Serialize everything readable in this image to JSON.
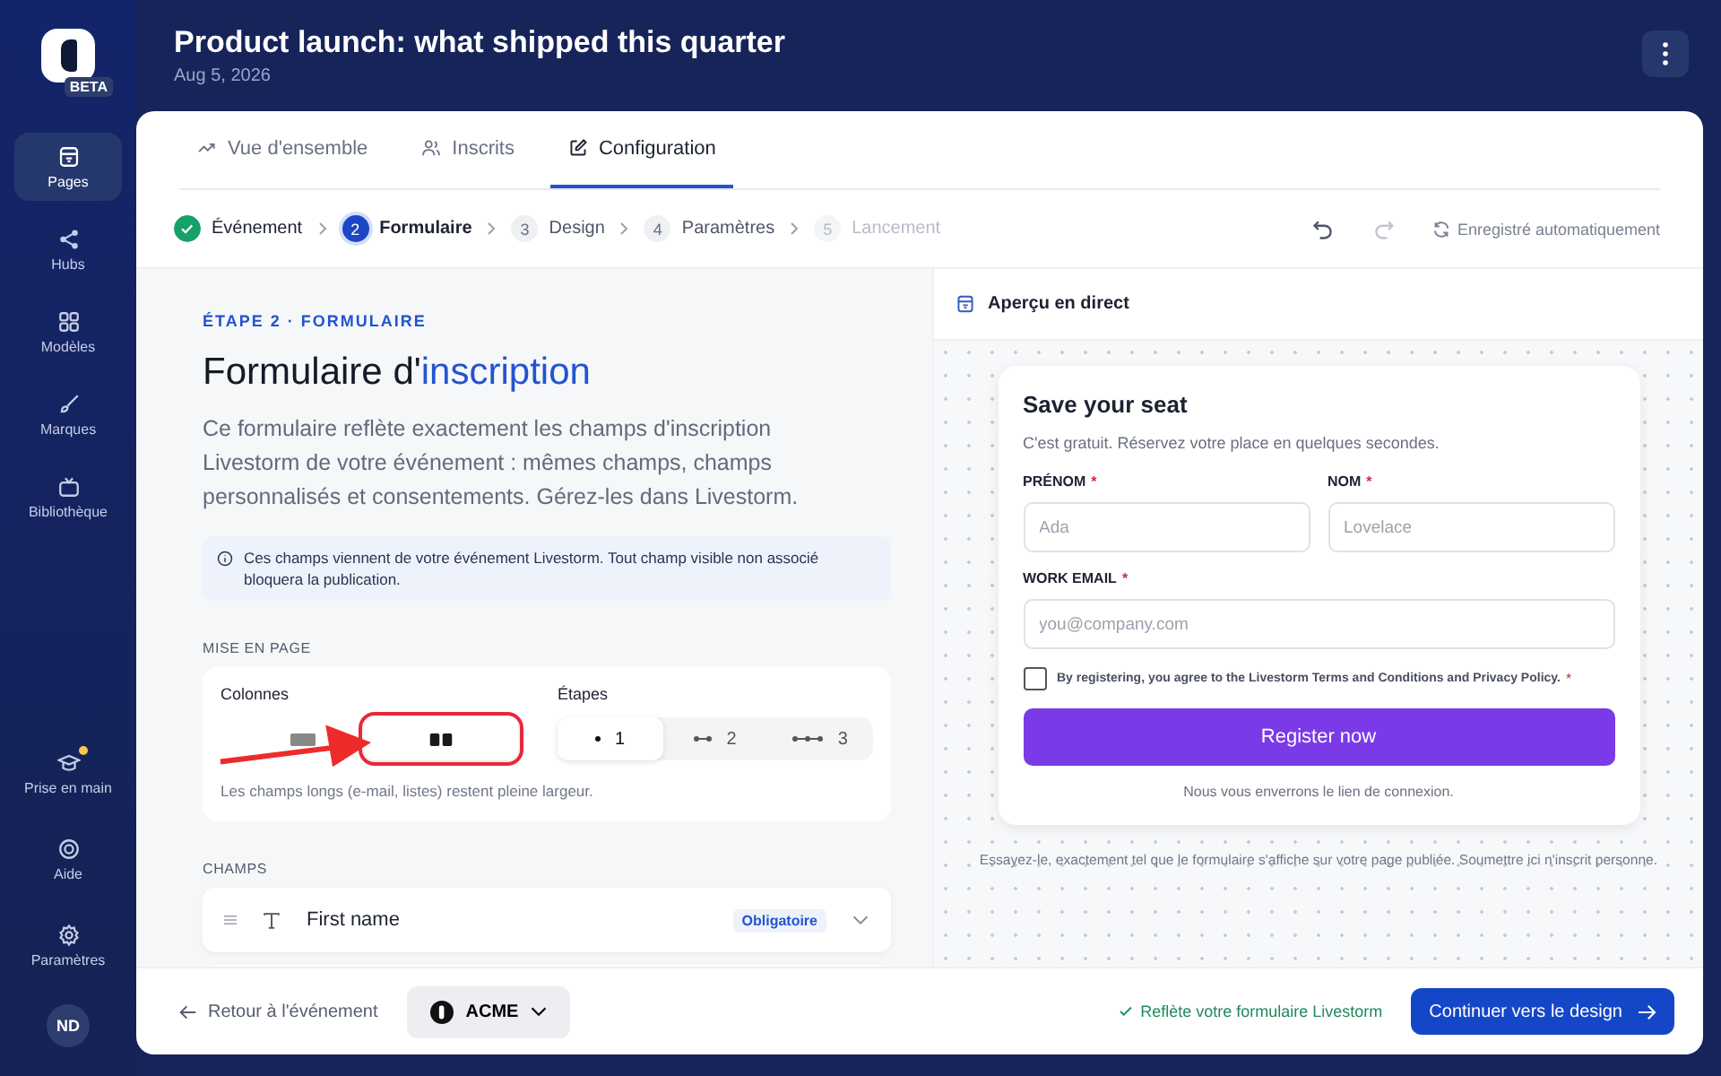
{
  "brand": {
    "badge": "BETA"
  },
  "sidebar": {
    "items": [
      {
        "label": "Pages",
        "selected": true
      },
      {
        "label": "Hubs",
        "selected": false
      },
      {
        "label": "Modèles",
        "selected": false
      },
      {
        "label": "Marques",
        "selected": false
      },
      {
        "label": "Bibliothèque",
        "selected": false
      }
    ],
    "bottom_items": [
      {
        "label": "Prise en main",
        "notification": true
      },
      {
        "label": "Aide",
        "notification": false
      },
      {
        "label": "Paramètres",
        "notification": false
      }
    ],
    "avatar": {
      "initials": "ND"
    }
  },
  "header": {
    "title": "Product launch: what shipped this quarter",
    "date": "Aug 5, 2026"
  },
  "tabs": [
    {
      "label": "Vue d'ensemble",
      "selected": false
    },
    {
      "label": "Inscrits",
      "selected": false
    },
    {
      "label": "Configuration",
      "selected": true
    }
  ],
  "stepper": {
    "steps": [
      {
        "label": "Événement",
        "done": true,
        "selected": false,
        "disabled": false
      },
      {
        "number": "2",
        "label": "Formulaire",
        "done": false,
        "selected": true,
        "disabled": false
      },
      {
        "number": "3",
        "label": "Design",
        "done": false,
        "selected": false,
        "disabled": false
      },
      {
        "number": "4",
        "label": "Paramètres",
        "done": false,
        "selected": false,
        "disabled": false
      },
      {
        "number": "5",
        "label": "Lancement",
        "done": false,
        "selected": false,
        "disabled": true
      }
    ],
    "actions": [
      {
        "kind": "undo",
        "disabled": false
      },
      {
        "kind": "redo",
        "disabled": true
      }
    ],
    "autosave": "Enregistré automatiquement"
  },
  "editor": {
    "eyebrow": "ÉTAPE 2 · FORMULAIRE",
    "title": "Formulaire d'",
    "title_accent": "inscription",
    "description": "Ce formulaire reflète exactement les champs d'inscription Livestorm de votre événement : mêmes champs, champs personnalisés et consentements. Gérez-les dans Livestorm.",
    "info_note": "Ces champs viennent de votre événement Livestorm. Tout champ visible non associé bloquera la publication.",
    "layout": {
      "section_label": "MISE EN PAGE",
      "annotation_arrow": true,
      "columns": {
        "label": "Colonnes",
        "options": [
          {
            "kind": "single",
            "selected": false,
            "highlighted": false
          },
          {
            "kind": "double",
            "selected": true,
            "highlighted": true
          }
        ]
      },
      "steps": {
        "label": "Étapes",
        "options": [
          {
            "label": "1",
            "selected": true
          },
          {
            "label": "2",
            "selected": false
          },
          {
            "label": "3",
            "selected": false
          }
        ]
      },
      "hint": "Les champs longs (e-mail, listes) restent pleine largeur."
    },
    "fields_section": {
      "label": "CHAMPS",
      "fields": [
        {
          "name": "First name",
          "badge": "Obligatoire"
        }
      ]
    }
  },
  "preview": {
    "title": "Aperçu en direct",
    "card": {
      "heading": "Save your seat",
      "subheading": "C'est gratuit. Réservez votre place en quelques secondes.",
      "required_mark": "*",
      "rows": [
        [
          {
            "label": "PRÉNOM",
            "required": true,
            "placeholder": "Ada"
          },
          {
            "label": "NOM",
            "required": true,
            "placeholder": "Lovelace"
          }
        ],
        [
          {
            "label": "WORK EMAIL",
            "required": true,
            "placeholder": "you@company.com"
          }
        ]
      ],
      "consent": {
        "text": "By registering, you agree to the Livestorm Terms and Conditions and Privacy Policy.",
        "required": true,
        "checked": false
      },
      "button": "Register now",
      "footnote": "Nous vous enverrons le lien de connexion."
    },
    "note": "Essayez-le, exactement tel que le formulaire s'affiche sur votre page publiée. Soumettre ici n'inscrit personne."
  },
  "footer": {
    "back": "Retour à l'événement",
    "brand": "ACME",
    "status": "Reflète votre formulaire Livestorm",
    "primary": "Continuer vers le design"
  }
}
